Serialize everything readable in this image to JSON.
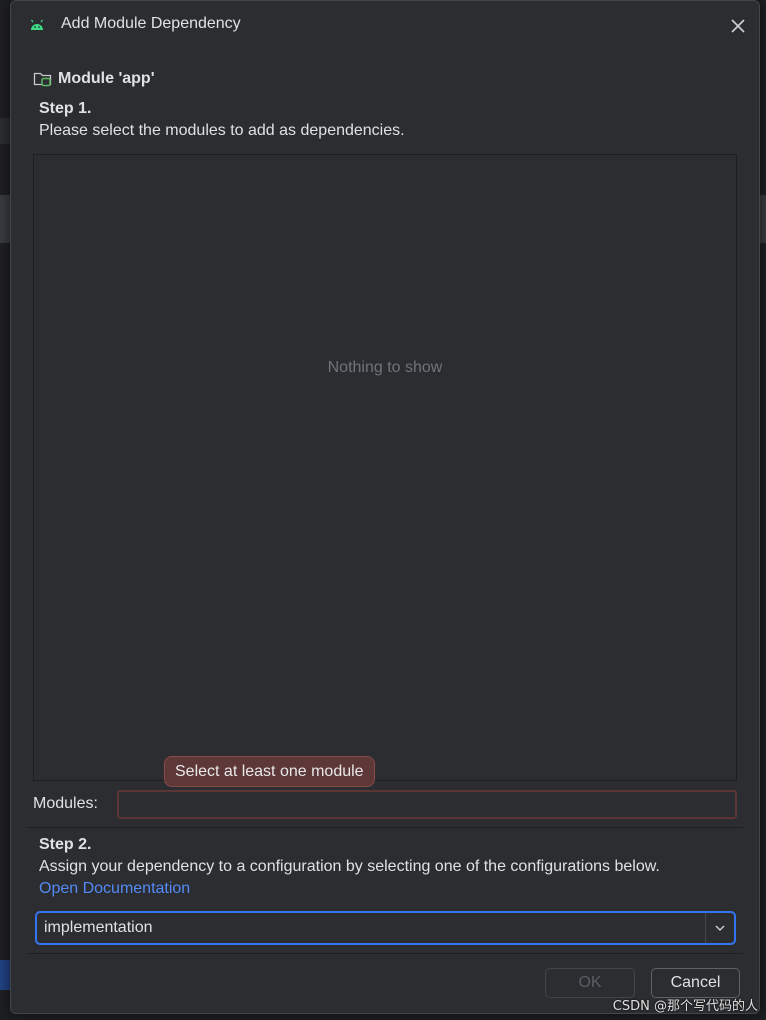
{
  "dialog": {
    "title": "Add Module Dependency",
    "module_header": "Module 'app'"
  },
  "step1": {
    "title": "Step 1.",
    "description": "Please select the modules to add as dependencies.",
    "empty_text": "Nothing to show",
    "tooltip": "Select at least one module",
    "modules_label": "Modules:",
    "modules_value": ""
  },
  "step2": {
    "title": "Step 2.",
    "description": "Assign your dependency to a configuration by selecting one of the configurations below.",
    "doc_link": "Open Documentation",
    "configuration": "implementation"
  },
  "buttons": {
    "ok": "OK",
    "cancel": "Cancel"
  },
  "watermark": "CSDN @那个写代码的人",
  "colors": {
    "background": "#2b2d30",
    "accent": "#3574f0",
    "link": "#548af7",
    "error_border": "#5c3535",
    "android_green": "#3ddc84"
  }
}
